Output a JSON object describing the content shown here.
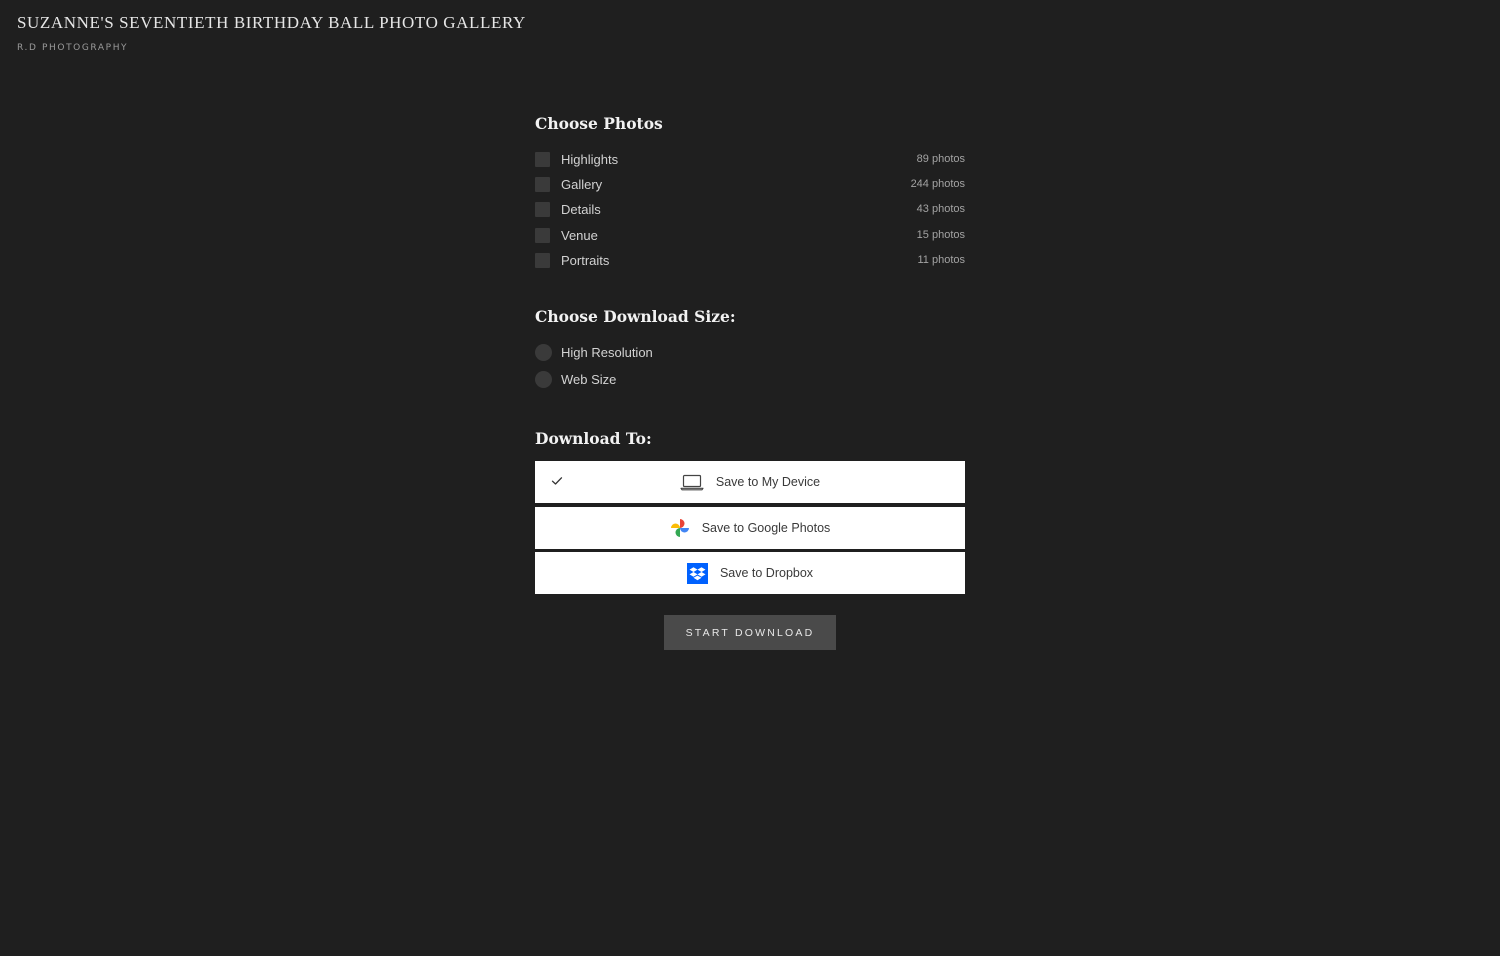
{
  "header": {
    "title": "SUZANNE'S SEVENTIETH BIRTHDAY BALL PHOTO GALLERY",
    "studio": "R.D PHOTOGRAPHY"
  },
  "choose_photos": {
    "title": "Choose Photos",
    "items": [
      {
        "label": "Highlights",
        "count": "89 photos"
      },
      {
        "label": "Gallery",
        "count": "244 photos"
      },
      {
        "label": "Details",
        "count": "43 photos"
      },
      {
        "label": "Venue",
        "count": "15 photos"
      },
      {
        "label": "Portraits",
        "count": "11 photos"
      }
    ]
  },
  "download_size": {
    "title": "Choose Download Size:",
    "options": [
      {
        "label": "High Resolution"
      },
      {
        "label": "Web Size"
      }
    ]
  },
  "download_to": {
    "title": "Download To:",
    "destinations": [
      {
        "label": "Save to My Device",
        "icon": "laptop-icon",
        "selected": true
      },
      {
        "label": "Save to Google Photos",
        "icon": "google-photos-icon",
        "selected": false
      },
      {
        "label": "Save to Dropbox",
        "icon": "dropbox-icon",
        "selected": false
      }
    ]
  },
  "actions": {
    "start_label": "START DOWNLOAD"
  },
  "colors": {
    "background": "#1f1f1f",
    "control": "#3a3a3a",
    "button": "#4a4a4a",
    "dropbox_blue": "#0061fe"
  }
}
